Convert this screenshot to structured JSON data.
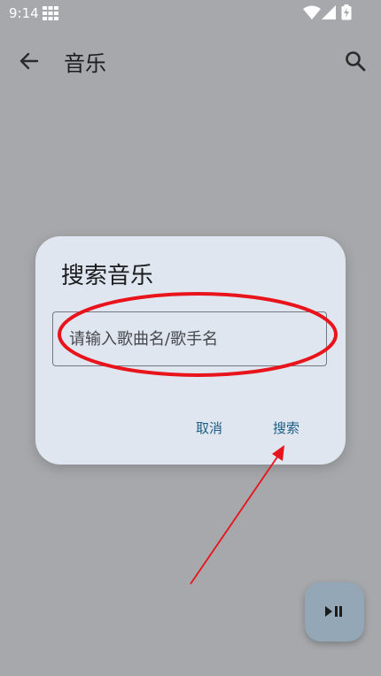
{
  "status_bar": {
    "time": "9:14",
    "icons": [
      "grid-icon",
      "wifi-icon",
      "signal-icon",
      "battery-icon"
    ]
  },
  "app_bar": {
    "title": "音乐",
    "back_icon": "arrow-left-icon",
    "search_icon": "search-icon"
  },
  "dialog": {
    "title": "搜索音乐",
    "input_placeholder": "请输入歌曲名/歌手名",
    "input_value": "",
    "cancel_label": "取消",
    "search_label": "搜索"
  },
  "fab": {
    "icon": "play-pause-icon"
  },
  "colors": {
    "background": "#a6a8ab",
    "dialog_bg": "#e0e6ef",
    "button_text": "#1b5e85",
    "fab_bg": "#93a7b7",
    "annotation": "#e8131b"
  }
}
